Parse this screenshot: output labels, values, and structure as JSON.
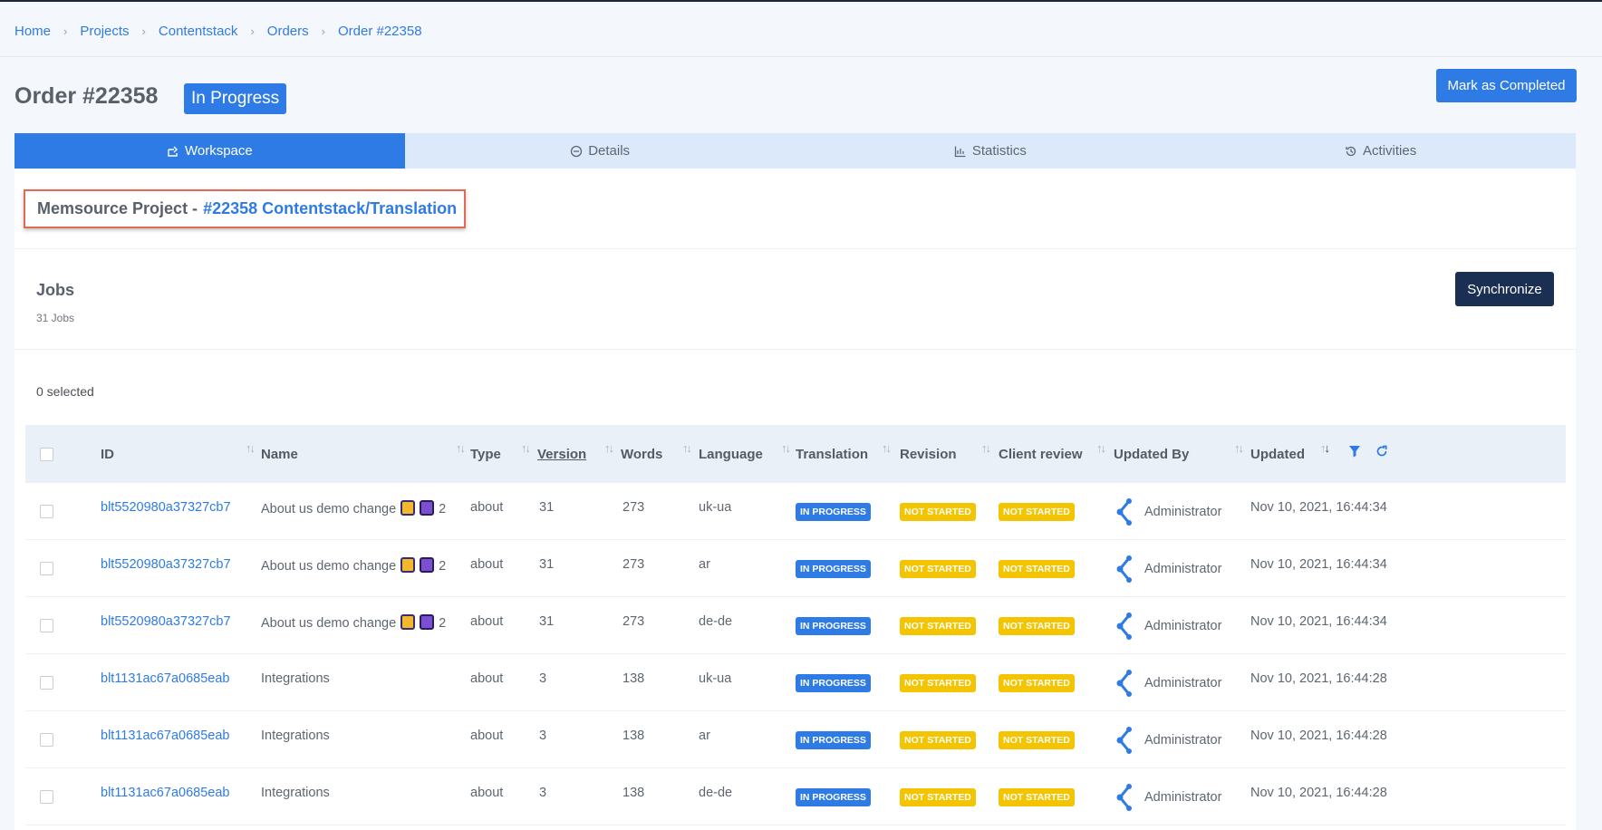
{
  "breadcrumb": [
    "Home",
    "Projects",
    "Contentstack",
    "Orders",
    "Order #22358"
  ],
  "order": {
    "title": "Order #22358",
    "status": "In Progress",
    "complete_label": "Mark as Completed"
  },
  "tabs": [
    {
      "label": "Workspace",
      "icon": "share-icon"
    },
    {
      "label": "Details",
      "icon": "minus-circle-icon"
    },
    {
      "label": "Statistics",
      "icon": "chart-icon"
    },
    {
      "label": "Activities",
      "icon": "history-icon"
    }
  ],
  "memsource": {
    "label": "Memsource Project -",
    "link": "#22358 Contentstack/Translation"
  },
  "jobs": {
    "title": "Jobs",
    "count": "31 Jobs",
    "sync_label": "Synchronize",
    "selected": "0 selected"
  },
  "table": {
    "columns": [
      "ID",
      "Name",
      "Type",
      "Version",
      "Words",
      "Language",
      "Translation",
      "Revision",
      "Client review",
      "Updated By",
      "Updated"
    ],
    "rows": [
      {
        "id": "blt5520980a37327cb7",
        "name": "About us demo change",
        "extra": "2",
        "type": "about",
        "version": "31",
        "words": "273",
        "language": "uk-ua",
        "translation": "IN PROGRESS",
        "revision": "NOT STARTED",
        "client_review": "NOT STARTED",
        "updated_by": "Administrator",
        "updated": "Nov 10, 2021, 16:44:34"
      },
      {
        "id": "blt5520980a37327cb7",
        "name": "About us demo change",
        "extra": "2",
        "type": "about",
        "version": "31",
        "words": "273",
        "language": "ar",
        "translation": "IN PROGRESS",
        "revision": "NOT STARTED",
        "client_review": "NOT STARTED",
        "updated_by": "Administrator",
        "updated": "Nov 10, 2021, 16:44:34"
      },
      {
        "id": "blt5520980a37327cb7",
        "name": "About us demo change",
        "extra": "2",
        "type": "about",
        "version": "31",
        "words": "273",
        "language": "de-de",
        "translation": "IN PROGRESS",
        "revision": "NOT STARTED",
        "client_review": "NOT STARTED",
        "updated_by": "Administrator",
        "updated": "Nov 10, 2021, 16:44:34"
      },
      {
        "id": "blt1131ac67a0685eab",
        "name": "Integrations",
        "extra": "",
        "type": "about",
        "version": "3",
        "words": "138",
        "language": "uk-ua",
        "translation": "IN PROGRESS",
        "revision": "NOT STARTED",
        "client_review": "NOT STARTED",
        "updated_by": "Administrator",
        "updated": "Nov 10, 2021, 16:44:28"
      },
      {
        "id": "blt1131ac67a0685eab",
        "name": "Integrations",
        "extra": "",
        "type": "about",
        "version": "3",
        "words": "138",
        "language": "ar",
        "translation": "IN PROGRESS",
        "revision": "NOT STARTED",
        "client_review": "NOT STARTED",
        "updated_by": "Administrator",
        "updated": "Nov 10, 2021, 16:44:28"
      },
      {
        "id": "blt1131ac67a0685eab",
        "name": "Integrations",
        "extra": "",
        "type": "about",
        "version": "3",
        "words": "138",
        "language": "de-de",
        "translation": "IN PROGRESS",
        "revision": "NOT STARTED",
        "client_review": "NOT STARTED",
        "updated_by": "Administrator",
        "updated": "Nov 10, 2021, 16:44:28"
      }
    ]
  },
  "colors": {
    "accent": "#2f7be5",
    "dark": "#1b2f52",
    "warning": "#f5c400",
    "highlight": "#e06a55"
  }
}
